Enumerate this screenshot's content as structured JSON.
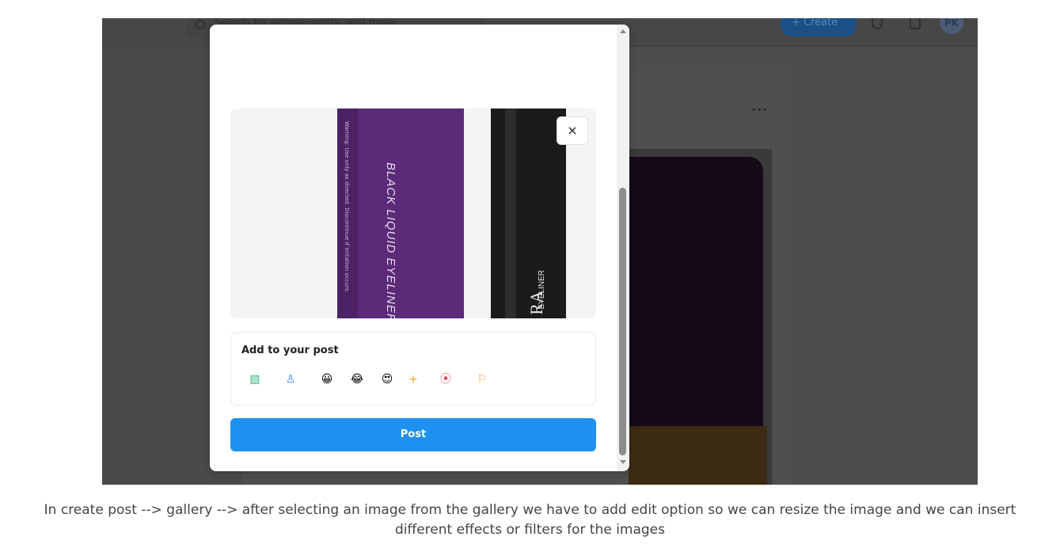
{
  "background_app": {
    "search_placeholder": "Search for people, posts, and more",
    "create_label": "+ Create",
    "avatar_initials": "PK",
    "feed_more_label": "···"
  },
  "modal": {
    "remove_image_label": "×",
    "product_image": {
      "box_text": "BLACK LIQUID EYELINER",
      "box_small_text": "Warning: Use only as directed. Discontinue if irritation occurs.",
      "pen_logo": "RA",
      "pen_text": "EYELINER"
    },
    "add_to_post": {
      "title": "Add to your post",
      "tools": [
        {
          "name": "photo-icon",
          "glyph": "▨",
          "color": "#36b37e"
        },
        {
          "name": "tag-people-icon",
          "glyph": "♙",
          "color": "#3b82f6"
        },
        {
          "name": "smile-emoji-icon",
          "glyph": "😀"
        },
        {
          "name": "laugh-emoji-icon",
          "glyph": "😂"
        },
        {
          "name": "heart-eyes-emoji-icon",
          "glyph": "😍"
        },
        {
          "name": "plus-icon",
          "glyph": "+",
          "color": "#f5a623"
        },
        {
          "name": "location-icon",
          "glyph": "⦿",
          "color": "#e5484d"
        },
        {
          "name": "flag-icon",
          "glyph": "⚐",
          "color": "#f5a623"
        }
      ]
    },
    "post_label": "Post"
  },
  "caption": {
    "line1": "In create post --> gallery --> after selecting an image from the gallery we have to add edit option so we can resize the image and we can insert",
    "line2": "different effects or filters for the images"
  }
}
